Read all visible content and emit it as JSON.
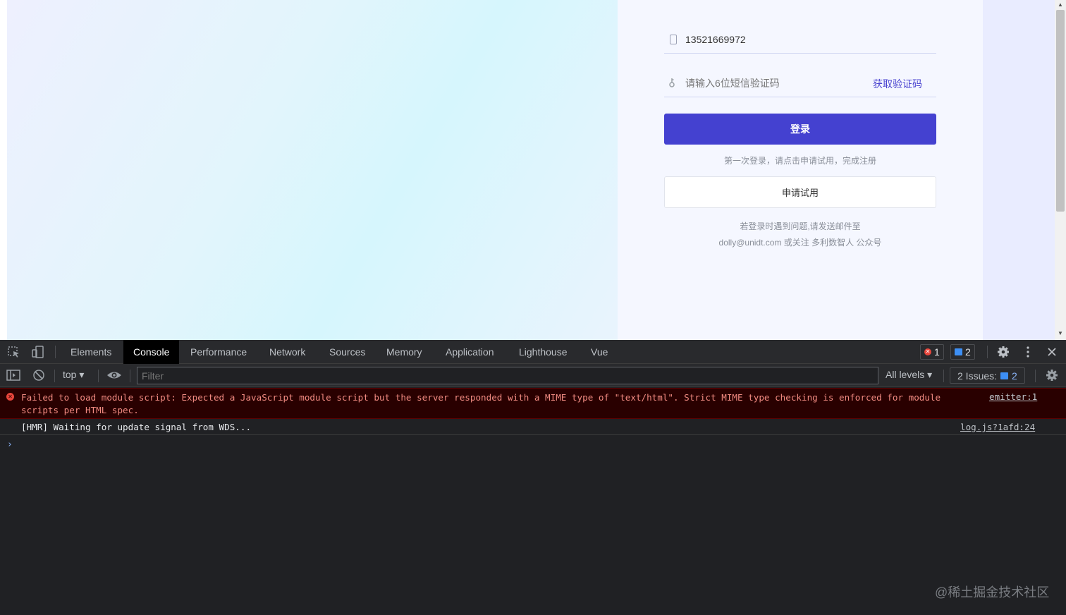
{
  "login": {
    "phone_value": "13521669972",
    "code_placeholder": "请输入6位短信验证码",
    "get_code_label": "获取验证码",
    "login_button": "登录",
    "first_login_hint": "第一次登录，请点击申请试用，完成注册",
    "trial_button": "申请试用",
    "help_line1": "若登录时遇到问题,请发送邮件至",
    "help_line2": "dolly@unidt.com 或关注 多利数智人 公众号",
    "accent_color": "#4441d0"
  },
  "devtools": {
    "tabs": [
      "Elements",
      "Console",
      "Performance",
      "Network",
      "Sources",
      "Memory",
      "Application",
      "Lighthouse",
      "Vue"
    ],
    "active_tab": "Console",
    "error_count": "1",
    "message_count": "2",
    "context": "top",
    "filter_placeholder": "Filter",
    "levels": "All levels",
    "issues_label": "2 Issues:",
    "issues_count": "2",
    "logs": [
      {
        "level": "error",
        "text": "Failed to load module script: Expected a JavaScript module script but the server responded with a MIME type of \"text/html\". Strict MIME type checking is enforced for module scripts per HTML spec.",
        "source": "emitter:1"
      },
      {
        "level": "info",
        "text": "[HMR] Waiting for update signal from WDS...",
        "source": "log.js?1afd:24"
      }
    ],
    "prompt_symbol": "›"
  },
  "watermark": "@稀土掘金技术社区"
}
